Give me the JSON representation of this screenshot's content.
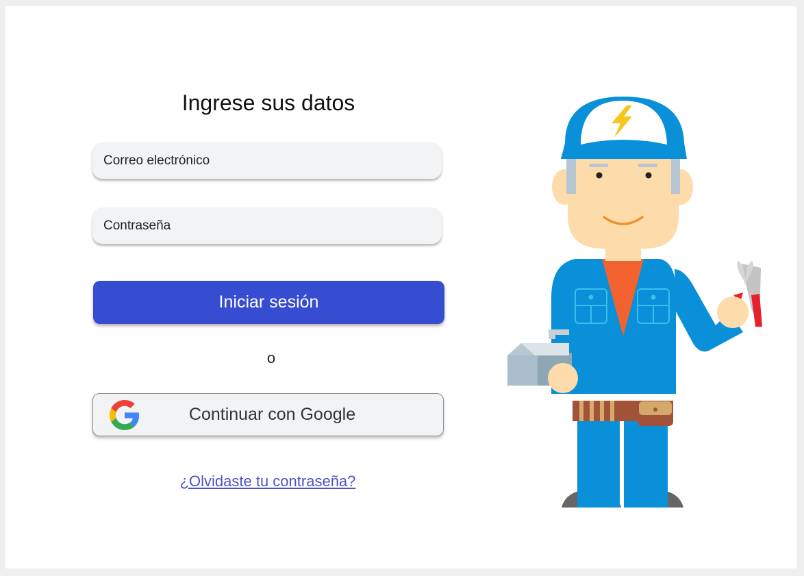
{
  "login": {
    "title": "Ingrese sus datos",
    "email_placeholder": "Correo electrónico",
    "password_placeholder": "Contraseña",
    "submit_label": "Iniciar sesión",
    "separator": "o",
    "google_label": "Continuar con Google",
    "forgot_password": "¿Olvidaste tu contraseña?"
  },
  "illustration": {
    "subject": "electrician-worker",
    "icons": [
      "lightning-bolt-icon",
      "pliers-icon",
      "toolbox-icon",
      "google-g-icon"
    ]
  },
  "colors": {
    "primary": "#364dd1",
    "link": "#4d52c9",
    "field_bg": "#f2f3f5",
    "worker_blue": "#0a8fd9"
  }
}
